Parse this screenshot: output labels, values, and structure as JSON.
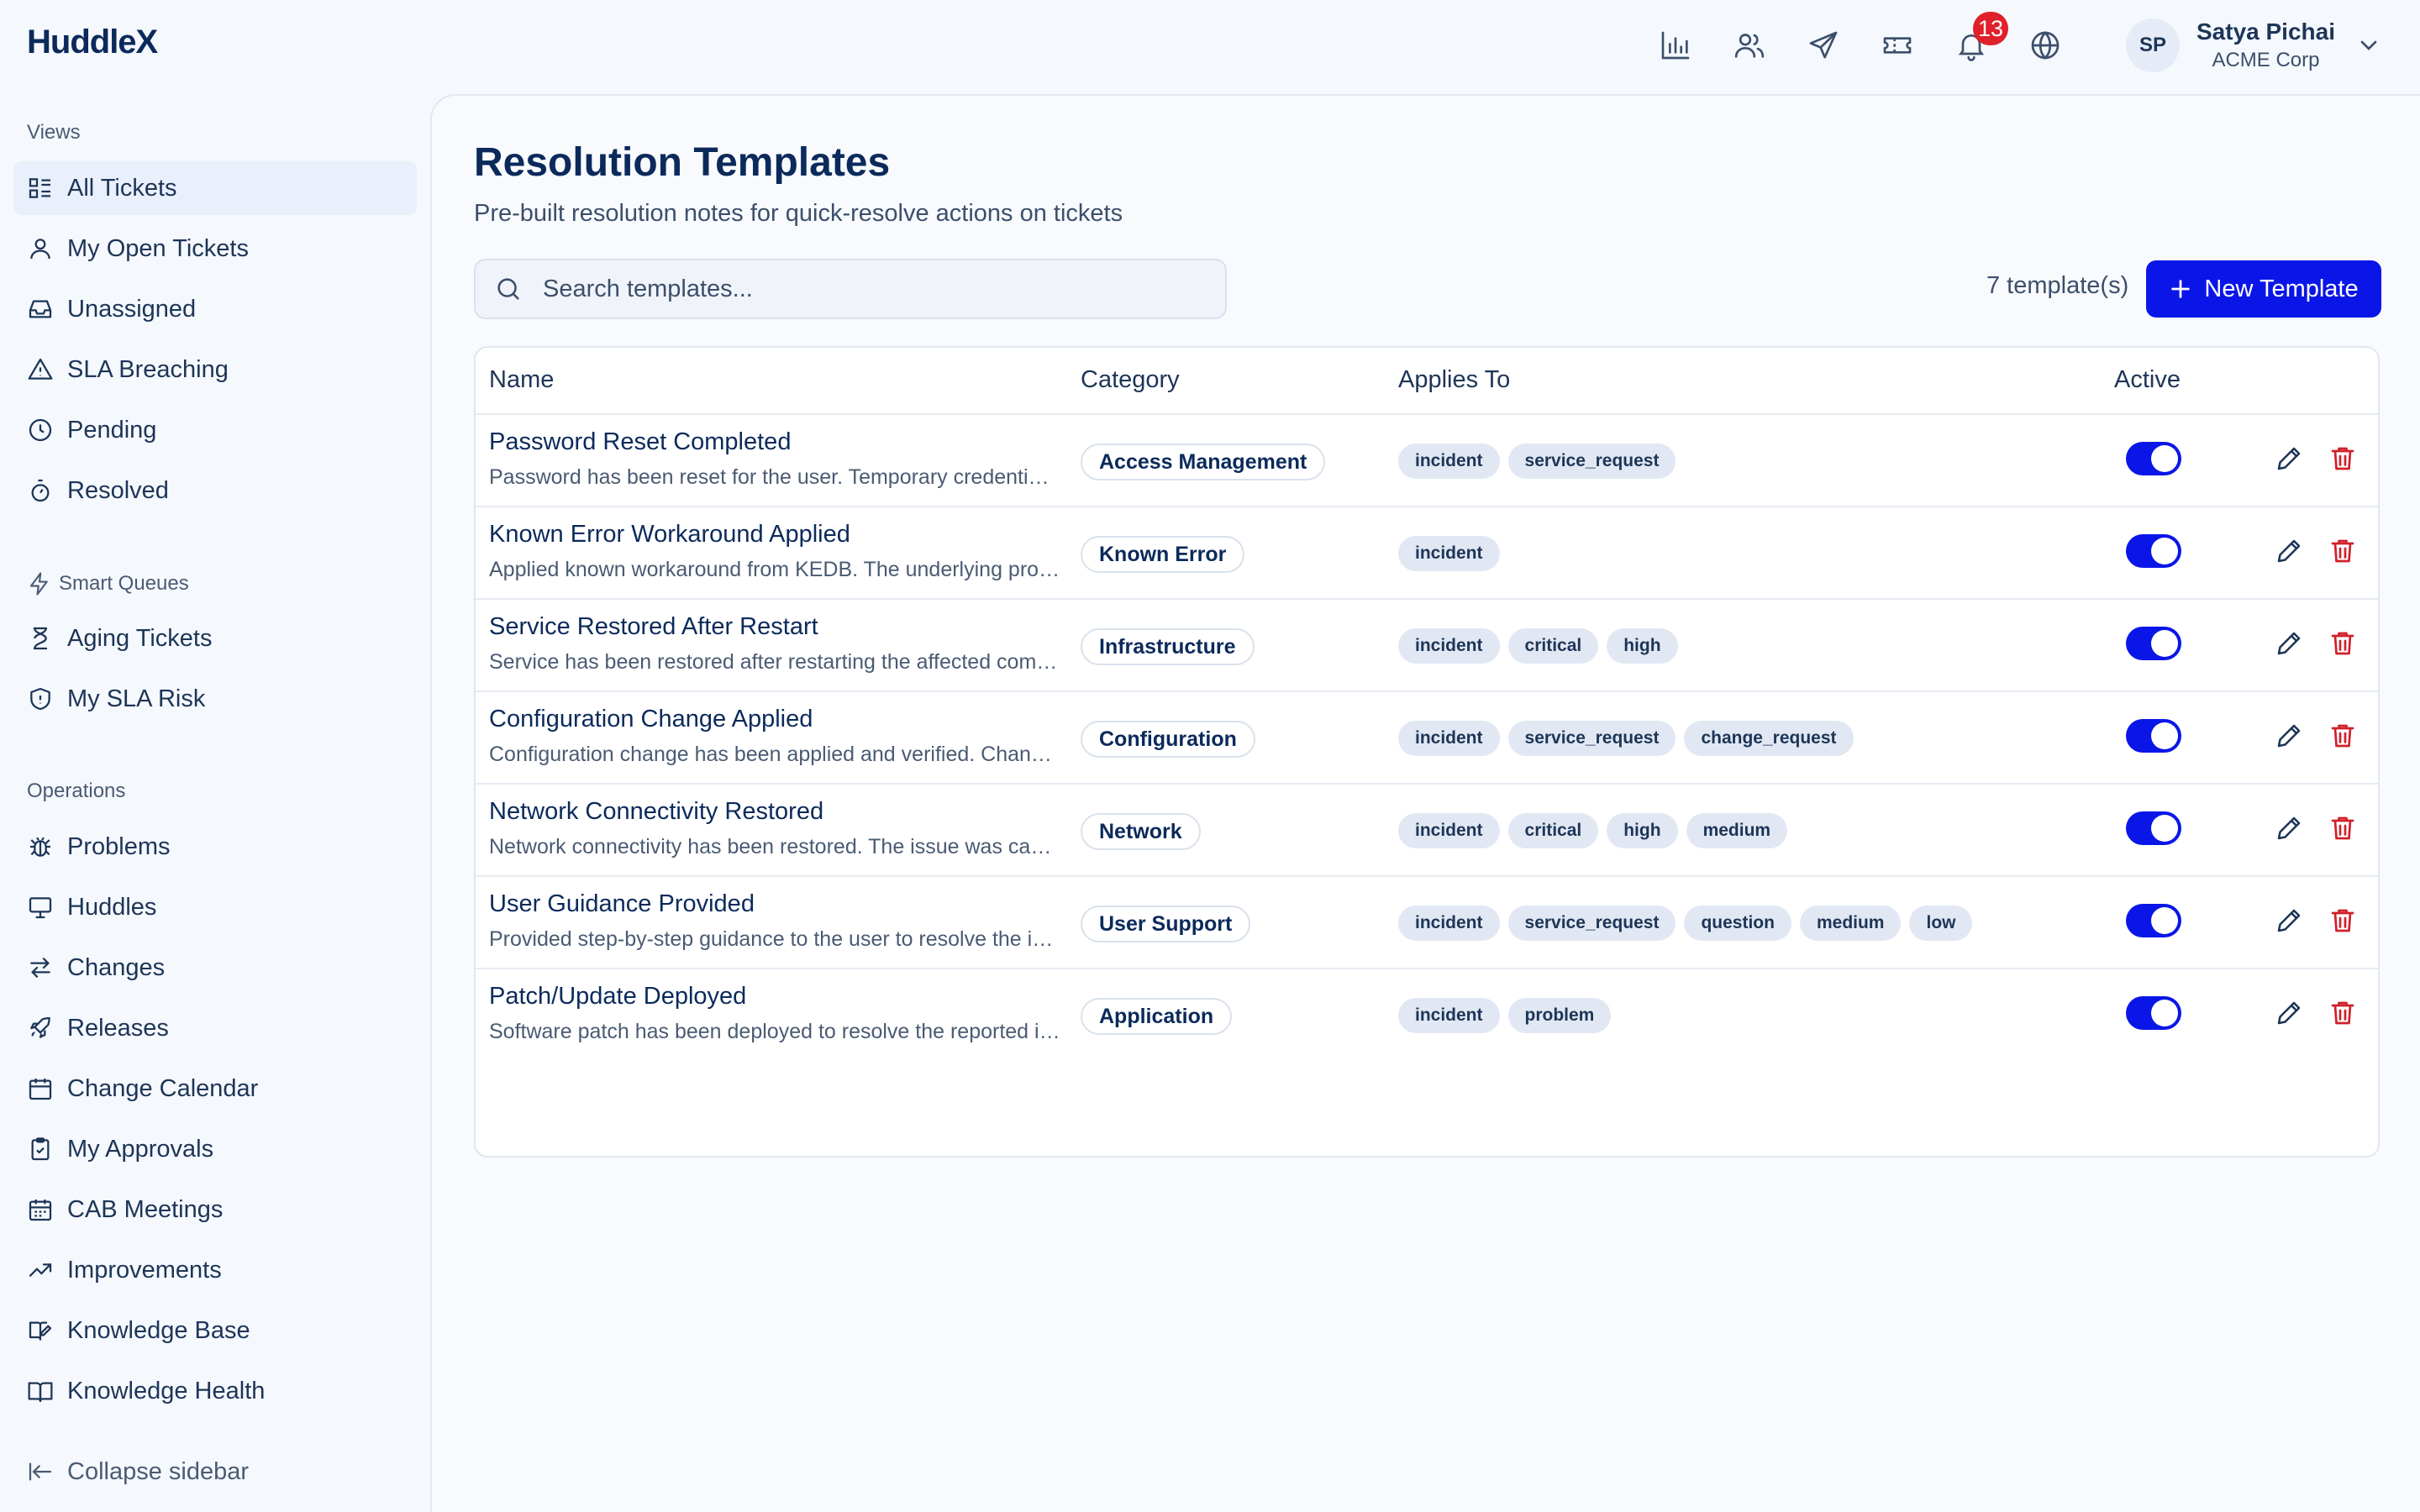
{
  "app": {
    "logo": "HuddleX"
  },
  "header": {
    "icons": [
      "analytics-icon",
      "users-icon",
      "send-icon",
      "ticket-icon",
      "bell-icon",
      "globe-icon"
    ],
    "notification_count": "13",
    "user": {
      "initials": "SP",
      "name": "Satya Pichai",
      "org": "ACME Corp"
    }
  },
  "sidebar": {
    "views_label": "Views",
    "views": [
      {
        "label": "All Tickets",
        "icon": "list-icon",
        "active": true
      },
      {
        "label": "My Open Tickets",
        "icon": "user-icon"
      },
      {
        "label": "Unassigned",
        "icon": "inbox-icon"
      },
      {
        "label": "SLA Breaching",
        "icon": "warning-icon"
      },
      {
        "label": "Pending",
        "icon": "clock-icon"
      },
      {
        "label": "Resolved",
        "icon": "timer-icon"
      }
    ],
    "smart_label": "Smart Queues",
    "smart": [
      {
        "label": "Aging Tickets",
        "icon": "hourglass-icon"
      },
      {
        "label": "My SLA Risk",
        "icon": "shield-icon"
      }
    ],
    "ops_label": "Operations",
    "ops": [
      {
        "label": "Problems",
        "icon": "bug-icon"
      },
      {
        "label": "Huddles",
        "icon": "monitor-icon"
      },
      {
        "label": "Changes",
        "icon": "arrows-icon"
      },
      {
        "label": "Releases",
        "icon": "rocket-icon"
      },
      {
        "label": "Change Calendar",
        "icon": "calendar-icon"
      },
      {
        "label": "My Approvals",
        "icon": "clipboard-check-icon"
      },
      {
        "label": "CAB Meetings",
        "icon": "calendar-grid-icon"
      },
      {
        "label": "Improvements",
        "icon": "trending-up-icon"
      },
      {
        "label": "Knowledge Base",
        "icon": "book-edit-icon"
      },
      {
        "label": "Knowledge Health",
        "icon": "book-icon"
      }
    ],
    "collapse_label": "Collapse sidebar"
  },
  "main": {
    "title": "Resolution Templates",
    "subtitle": "Pre-built resolution notes for quick-resolve actions on tickets",
    "search_placeholder": "Search templates...",
    "template_count": "7 template(s)",
    "new_button": "New Template",
    "columns": {
      "name": "Name",
      "category": "Category",
      "applies": "Applies To",
      "active": "Active"
    },
    "rows": [
      {
        "name": "Password Reset Completed",
        "desc": "Password has been reset for the user. Temporary credentials have been shared securely.",
        "category": "Access Management",
        "applies": [
          "incident",
          "service_request"
        ],
        "active": true
      },
      {
        "name": "Known Error Workaround Applied",
        "desc": "Applied known workaround from KEDB. The underlying problem is being tracked.",
        "category": "Known Error",
        "applies": [
          "incident"
        ],
        "active": true
      },
      {
        "name": "Service Restored After Restart",
        "desc": "Service has been restored after restarting the affected component.",
        "category": "Infrastructure",
        "applies": [
          "incident",
          "critical",
          "high"
        ],
        "active": true
      },
      {
        "name": "Configuration Change Applied",
        "desc": "Configuration change has been applied and verified. Change has been recorded.",
        "category": "Configuration",
        "applies": [
          "incident",
          "service_request",
          "change_request"
        ],
        "active": true
      },
      {
        "name": "Network Connectivity Restored",
        "desc": "Network connectivity has been restored. The issue was caused by a faulty link.",
        "category": "Network",
        "applies": [
          "incident",
          "critical",
          "high",
          "medium"
        ],
        "active": true
      },
      {
        "name": "User Guidance Provided",
        "desc": "Provided step-by-step guidance to the user to resolve the issue.",
        "category": "User Support",
        "applies": [
          "incident",
          "service_request",
          "question",
          "medium",
          "low"
        ],
        "active": true
      },
      {
        "name": "Patch/Update Deployed",
        "desc": "Software patch has been deployed to resolve the reported issue.",
        "category": "Application",
        "applies": [
          "incident",
          "problem"
        ],
        "active": true
      }
    ]
  }
}
